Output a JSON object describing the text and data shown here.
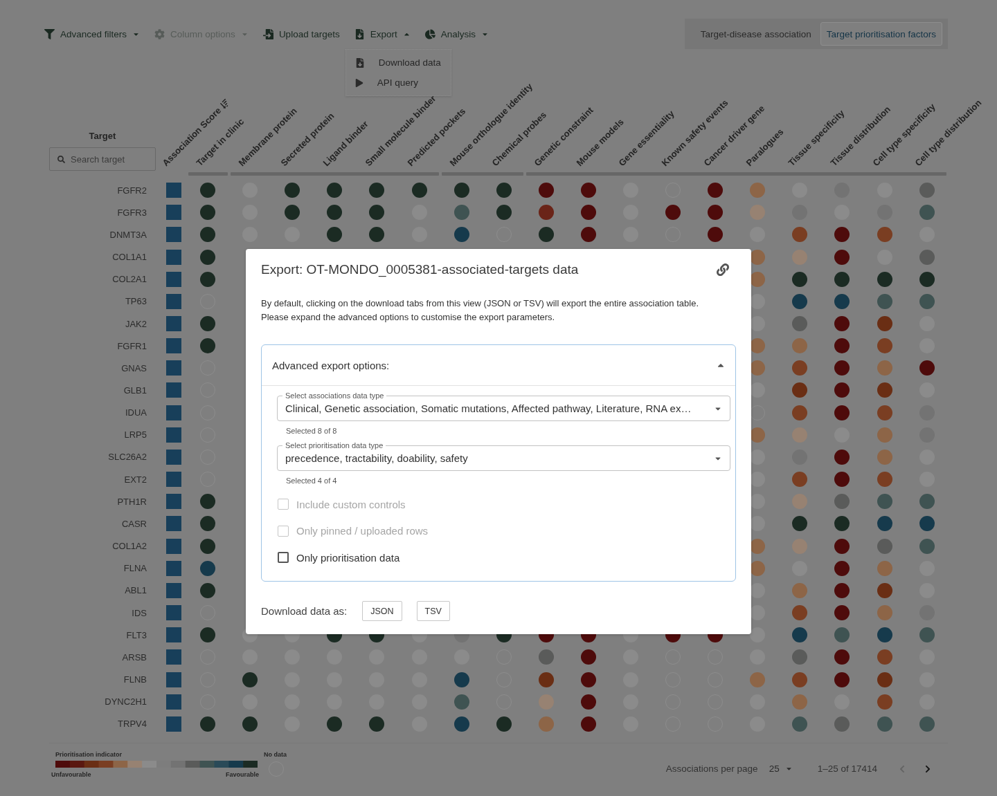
{
  "toolbar": [
    {
      "kind": "filter",
      "label": "Advanced filters",
      "disabled": false,
      "expanded": false
    },
    {
      "kind": "columns",
      "label": "Column options",
      "disabled": true,
      "expanded": false
    },
    {
      "kind": "upload",
      "label": "Upload targets",
      "disabled": false
    },
    {
      "kind": "export",
      "label": "Export",
      "disabled": false,
      "expanded": true,
      "menu": [
        {
          "kind": "download",
          "label": "Download data"
        },
        {
          "kind": "api",
          "label": "API query"
        }
      ]
    },
    {
      "kind": "analysis",
      "label": "Analysis",
      "disabled": false,
      "expanded": false
    }
  ],
  "view_toggle": [
    {
      "label": "Target-disease association",
      "selected": false
    },
    {
      "label": "Target prioritisation factors",
      "selected": true
    }
  ],
  "table": {
    "target_heading": "Target",
    "search": {
      "placeholder": "Search target"
    },
    "score_column": {
      "label": "Association Score",
      "sorted": true
    },
    "column_groups": [
      {
        "columns": [
          "Target in clinic"
        ]
      },
      {
        "columns": [
          "Membrane protein",
          "Secreted protein",
          "Ligand binder",
          "Small molecule binder",
          "Predicted pockets"
        ]
      },
      {
        "columns": [
          "Mouse orthologue identity",
          "Chemical probes"
        ]
      },
      {
        "columns": [
          "Genetic constraint",
          "Mouse models",
          "Gene essentiality",
          "Known safety events",
          "Cancer driver gene",
          "Paralogues",
          "Tissue specificity",
          "Tissue distribution",
          "Cell type specificity",
          "Cell type distribution"
        ]
      }
    ],
    "rows": [
      {
        "target": "FGFR2",
        "score": {
          "color": "#183f5a"
        },
        "cells": [
          {
            "kind": "dot",
            "color": "#1b2b23"
          },
          {
            "kind": "dot",
            "color": "#8b8b8b"
          },
          {
            "kind": "dot",
            "color": "#1b2b23"
          },
          {
            "kind": "dot",
            "color": "#1b2b23"
          },
          {
            "kind": "dot",
            "color": "#1b2b23"
          },
          {
            "kind": "dot",
            "color": "#1b2b23"
          },
          {
            "kind": "dot",
            "color": "#1b2b23"
          },
          {
            "kind": "dot",
            "color": "#1b2b23"
          },
          {
            "kind": "dot",
            "color": "#4e0b0b"
          },
          {
            "kind": "dot",
            "color": "#4e0b0b"
          },
          {
            "kind": "dot",
            "color": "#8b8b8b"
          },
          {
            "kind": "empty"
          },
          {
            "kind": "dot",
            "color": "#4e0b0b"
          },
          {
            "kind": "dot",
            "color": "#8d6547"
          },
          {
            "kind": "dot",
            "color": "#8b8b8b"
          },
          {
            "kind": "dot",
            "color": "#737373"
          },
          {
            "kind": "dot",
            "color": "#8b8b8b"
          },
          {
            "kind": "dot",
            "color": "#5a5b5a"
          }
        ]
      },
      {
        "target": "FGFR3",
        "score": {
          "color": "#183f5a"
        },
        "cells": [
          {
            "kind": "dot",
            "color": "#1b2b23"
          },
          {
            "kind": "dot",
            "color": "#8b8b8b"
          },
          {
            "kind": "dot",
            "color": "#1b2b23"
          },
          {
            "kind": "dot",
            "color": "#1b2b23"
          },
          {
            "kind": "dot",
            "color": "#1b2b23"
          },
          {
            "kind": "dot",
            "color": "#8b8b8b"
          },
          {
            "kind": "dot",
            "color": "#3f5352"
          },
          {
            "kind": "dot",
            "color": "#1b2b23"
          },
          {
            "kind": "dot",
            "color": "#6a2418"
          },
          {
            "kind": "dot",
            "color": "#4e0b0b"
          },
          {
            "kind": "dot",
            "color": "#8b8b8b"
          },
          {
            "kind": "dot",
            "color": "#4e0b0b"
          },
          {
            "kind": "dot",
            "color": "#4e0b0b"
          },
          {
            "kind": "dot",
            "color": "#978272"
          },
          {
            "kind": "dot",
            "color": "#737373"
          },
          {
            "kind": "dot",
            "color": "#8b8b8b"
          },
          {
            "kind": "dot",
            "color": "#737373"
          },
          {
            "kind": "dot",
            "color": "#3f5352"
          }
        ]
      },
      {
        "target": "DNMT3A",
        "score": {
          "color": "#183f5a"
        },
        "cells": [
          {
            "kind": "dot",
            "color": "#1b2b23"
          },
          {
            "kind": "dot",
            "color": "#8b8b8b"
          },
          {
            "kind": "dot",
            "color": "#8b8b8b"
          },
          {
            "kind": "dot",
            "color": "#1b2b23"
          },
          {
            "kind": "dot",
            "color": "#1b2b23"
          },
          {
            "kind": "dot",
            "color": "#8b8b8b"
          },
          {
            "kind": "dot",
            "color": "#163a4c"
          },
          {
            "kind": "empty"
          },
          {
            "kind": "dot",
            "color": "#1b2b23"
          },
          {
            "kind": "dot",
            "color": "#4e0b0b"
          },
          {
            "kind": "dot",
            "color": "#8b8b8b"
          },
          {
            "kind": "empty"
          },
          {
            "kind": "dot",
            "color": "#4e0b0b"
          },
          {
            "kind": "dot",
            "color": "#8b8b8b"
          },
          {
            "kind": "dot",
            "color": "#7a3e22"
          },
          {
            "kind": "dot",
            "color": "#4e0b0b"
          },
          {
            "kind": "dot",
            "color": "#7a3e22"
          },
          {
            "kind": "dot",
            "color": "#8b8b8b"
          }
        ]
      },
      {
        "target": "COL1A1",
        "score": {
          "color": "#183f5a"
        },
        "cells": [
          {
            "kind": "dot",
            "color": "#1b2b23"
          },
          null,
          null,
          null,
          null,
          null,
          null,
          null,
          null,
          null,
          null,
          null,
          null,
          {
            "kind": "dot",
            "color": "#8d6547"
          },
          {
            "kind": "dot",
            "color": "#978272"
          },
          {
            "kind": "dot",
            "color": "#4e0b0b"
          },
          {
            "kind": "dot",
            "color": "#8b8b8b"
          },
          {
            "kind": "dot",
            "color": "#5a5b5a"
          }
        ]
      },
      {
        "target": "COL2A1",
        "score": {
          "color": "#183f5a"
        },
        "cells": [
          {
            "kind": "dot",
            "color": "#1b2b23"
          },
          null,
          null,
          null,
          null,
          null,
          null,
          null,
          null,
          null,
          null,
          null,
          null,
          {
            "kind": "dot",
            "color": "#8d6547"
          },
          {
            "kind": "dot",
            "color": "#1b2b23"
          },
          {
            "kind": "dot",
            "color": "#1b2b23"
          },
          {
            "kind": "dot",
            "color": "#1b2b23"
          },
          {
            "kind": "dot",
            "color": "#1b2b23"
          }
        ]
      },
      {
        "target": "TP63",
        "score": {
          "color": "#183f5a"
        },
        "cells": [
          {
            "kind": "empty"
          },
          null,
          null,
          null,
          null,
          null,
          null,
          null,
          null,
          null,
          null,
          null,
          null,
          {
            "kind": "dot",
            "color": "#8b8b8b"
          },
          {
            "kind": "dot",
            "color": "#163a4c"
          },
          {
            "kind": "dot",
            "color": "#163a4c"
          },
          {
            "kind": "dot",
            "color": "#3f5352"
          },
          {
            "kind": "dot",
            "color": "#3f5352"
          }
        ]
      },
      {
        "target": "JAK2",
        "score": {
          "color": "#183f5a"
        },
        "cells": [
          {
            "kind": "dot",
            "color": "#1b2b23"
          },
          null,
          null,
          null,
          null,
          null,
          null,
          null,
          null,
          null,
          null,
          null,
          null,
          {
            "kind": "dot",
            "color": "#8b8b8b"
          },
          {
            "kind": "dot",
            "color": "#5a5b5a"
          },
          {
            "kind": "dot",
            "color": "#4e0b0b"
          },
          {
            "kind": "dot",
            "color": "#6a2e14"
          },
          {
            "kind": "dot",
            "color": "#8b8b8b"
          }
        ]
      },
      {
        "target": "FGFR1",
        "score": {
          "color": "#183f5a"
        },
        "cells": [
          {
            "kind": "dot",
            "color": "#1b2b23"
          },
          null,
          null,
          null,
          null,
          null,
          null,
          null,
          null,
          null,
          null,
          null,
          null,
          {
            "kind": "dot",
            "color": "#8d6547"
          },
          {
            "kind": "dot",
            "color": "#8d6547"
          },
          {
            "kind": "dot",
            "color": "#4e0b0b"
          },
          {
            "kind": "dot",
            "color": "#7a3e22"
          },
          {
            "kind": "dot",
            "color": "#8b8b8b"
          }
        ]
      },
      {
        "target": "GNAS",
        "score": {
          "color": "#183f5a"
        },
        "cells": [
          {
            "kind": "empty"
          },
          null,
          null,
          null,
          null,
          null,
          null,
          null,
          null,
          null,
          null,
          null,
          null,
          {
            "kind": "dot",
            "color": "#8d6547"
          },
          {
            "kind": "dot",
            "color": "#7a3e22"
          },
          {
            "kind": "dot",
            "color": "#4e0b0b"
          },
          {
            "kind": "dot",
            "color": "#8d6547"
          },
          {
            "kind": "dot",
            "color": "#4e0b0b"
          }
        ]
      },
      {
        "target": "GLB1",
        "score": {
          "color": "#183f5a"
        },
        "cells": [
          {
            "kind": "empty"
          },
          null,
          null,
          null,
          null,
          null,
          null,
          null,
          null,
          null,
          null,
          null,
          null,
          {
            "kind": "dot",
            "color": "#8b8b8b"
          },
          {
            "kind": "dot",
            "color": "#6a2e14"
          },
          {
            "kind": "dot",
            "color": "#4e0b0b"
          },
          {
            "kind": "dot",
            "color": "#6a2e14"
          },
          {
            "kind": "dot",
            "color": "#8b8b8b"
          }
        ]
      },
      {
        "target": "IDUA",
        "score": {
          "color": "#183f5a"
        },
        "cells": [
          {
            "kind": "empty"
          },
          null,
          null,
          null,
          null,
          null,
          null,
          null,
          null,
          null,
          null,
          null,
          null,
          {
            "kind": "empty"
          },
          {
            "kind": "dot",
            "color": "#7a3e22"
          },
          {
            "kind": "dot",
            "color": "#4e0b0b"
          },
          {
            "kind": "dot",
            "color": "#7a3e22"
          },
          {
            "kind": "dot",
            "color": "#737373"
          }
        ]
      },
      {
        "target": "LRP5",
        "score": {
          "color": "#183f5a"
        },
        "cells": [
          {
            "kind": "empty"
          },
          null,
          null,
          null,
          null,
          null,
          null,
          null,
          null,
          null,
          null,
          null,
          null,
          {
            "kind": "dot",
            "color": "#8d6547"
          },
          {
            "kind": "dot",
            "color": "#978272"
          },
          {
            "kind": "dot",
            "color": "#8b8b8b"
          },
          {
            "kind": "dot",
            "color": "#8d6547"
          },
          {
            "kind": "dot",
            "color": "#737373"
          }
        ]
      },
      {
        "target": "SLC26A2",
        "score": {
          "color": "#183f5a"
        },
        "cells": [
          {
            "kind": "empty"
          },
          null,
          null,
          null,
          null,
          null,
          null,
          null,
          null,
          null,
          null,
          null,
          null,
          {
            "kind": "dot",
            "color": "#8b8b8b"
          },
          {
            "kind": "dot",
            "color": "#737373"
          },
          {
            "kind": "dot",
            "color": "#4e0b0b"
          },
          {
            "kind": "dot",
            "color": "#8d6547"
          },
          {
            "kind": "dot",
            "color": "#8b8b8b"
          }
        ]
      },
      {
        "target": "EXT2",
        "score": {
          "color": "#183f5a"
        },
        "cells": [
          {
            "kind": "empty"
          },
          null,
          null,
          null,
          null,
          null,
          null,
          null,
          null,
          null,
          null,
          null,
          null,
          {
            "kind": "dot",
            "color": "#8b8b8b"
          },
          {
            "kind": "dot",
            "color": "#7a3e22"
          },
          {
            "kind": "dot",
            "color": "#4e0b0b"
          },
          {
            "kind": "dot",
            "color": "#7a3e22"
          },
          {
            "kind": "dot",
            "color": "#8b8b8b"
          }
        ]
      },
      {
        "target": "PTH1R",
        "score": {
          "color": "#183f5a"
        },
        "cells": [
          {
            "kind": "dot",
            "color": "#1b2b23"
          },
          null,
          null,
          null,
          null,
          null,
          null,
          null,
          null,
          null,
          null,
          null,
          null,
          {
            "kind": "dot",
            "color": "#8b8b8b"
          },
          {
            "kind": "dot",
            "color": "#978272"
          },
          {
            "kind": "dot",
            "color": "#5a5b5a"
          },
          {
            "kind": "dot",
            "color": "#3f5352"
          },
          {
            "kind": "dot",
            "color": "#3f5352"
          }
        ]
      },
      {
        "target": "CASR",
        "score": {
          "color": "#183f5a"
        },
        "cells": [
          {
            "kind": "dot",
            "color": "#1b2b23"
          },
          null,
          null,
          null,
          null,
          null,
          null,
          null,
          null,
          null,
          null,
          null,
          null,
          {
            "kind": "dot",
            "color": "#8b8b8b"
          },
          {
            "kind": "dot",
            "color": "#1b2b23"
          },
          {
            "kind": "dot",
            "color": "#1b2b23"
          },
          {
            "kind": "dot",
            "color": "#163a4c"
          },
          {
            "kind": "dot",
            "color": "#163a4c"
          }
        ]
      },
      {
        "target": "COL1A2",
        "score": {
          "color": "#183f5a"
        },
        "cells": [
          {
            "kind": "dot",
            "color": "#1b2b23"
          },
          null,
          null,
          null,
          null,
          null,
          null,
          null,
          null,
          null,
          null,
          null,
          null,
          {
            "kind": "dot",
            "color": "#8d6547"
          },
          {
            "kind": "dot",
            "color": "#978272"
          },
          {
            "kind": "dot",
            "color": "#4e0b0b"
          },
          {
            "kind": "dot",
            "color": "#5a5b5a"
          },
          {
            "kind": "dot",
            "color": "#3f5352"
          }
        ]
      },
      {
        "target": "FLNA",
        "score": {
          "color": "#183f5a"
        },
        "cells": [
          {
            "kind": "dot",
            "color": "#163a4c"
          },
          null,
          null,
          null,
          null,
          null,
          null,
          null,
          null,
          null,
          null,
          null,
          null,
          {
            "kind": "dot",
            "color": "#8d6547"
          },
          {
            "kind": "dot",
            "color": "#8b8b8b"
          },
          {
            "kind": "dot",
            "color": "#4e0b0b"
          },
          {
            "kind": "dot",
            "color": "#8d6547"
          },
          {
            "kind": "dot",
            "color": "#8b8b8b"
          }
        ]
      },
      {
        "target": "ABL1",
        "score": {
          "color": "#183f5a"
        },
        "cells": [
          {
            "kind": "dot",
            "color": "#1b2b23"
          },
          null,
          null,
          null,
          null,
          null,
          null,
          null,
          null,
          null,
          null,
          null,
          null,
          {
            "kind": "dot",
            "color": "#8b8b8b"
          },
          {
            "kind": "dot",
            "color": "#8d6547"
          },
          {
            "kind": "dot",
            "color": "#4e0b0b"
          },
          {
            "kind": "dot",
            "color": "#6a2e14"
          },
          {
            "kind": "dot",
            "color": "#8b8b8b"
          }
        ]
      },
      {
        "target": "IDS",
        "score": {
          "color": "#183f5a"
        },
        "cells": [
          {
            "kind": "empty"
          },
          null,
          null,
          null,
          null,
          null,
          null,
          null,
          null,
          null,
          null,
          null,
          null,
          {
            "kind": "dot",
            "color": "#8b8b8b"
          },
          {
            "kind": "dot",
            "color": "#7a3e22"
          },
          {
            "kind": "dot",
            "color": "#4e0b0b"
          },
          {
            "kind": "dot",
            "color": "#8d6547"
          },
          {
            "kind": "dot",
            "color": "#737373"
          }
        ]
      },
      {
        "target": "FLT3",
        "score": {
          "color": "#183f5a"
        },
        "cells": [
          {
            "kind": "dot",
            "color": "#1b2b23"
          },
          {
            "kind": "dot",
            "color": "#8b8b8b"
          },
          {
            "kind": "dot",
            "color": "#8b8b8b"
          },
          {
            "kind": "dot",
            "color": "#1b2b23"
          },
          {
            "kind": "dot",
            "color": "#1b2b23"
          },
          {
            "kind": "dot",
            "color": "#8b8b8b"
          },
          {
            "kind": "dot",
            "color": "#737373"
          },
          {
            "kind": "dot",
            "color": "#1b2b23"
          },
          {
            "kind": "dot",
            "color": "#4e0b0b"
          },
          {
            "kind": "dot",
            "color": "#4e0b0b"
          },
          {
            "kind": "dot",
            "color": "#8b8b8b"
          },
          {
            "kind": "dot",
            "color": "#4e0b0b"
          },
          {
            "kind": "dot",
            "color": "#4e0b0b"
          },
          {
            "kind": "dot",
            "color": "#8b8b8b"
          },
          {
            "kind": "dot",
            "color": "#163a4c"
          },
          {
            "kind": "dot",
            "color": "#3f5352"
          },
          {
            "kind": "dot",
            "color": "#163a4c"
          },
          {
            "kind": "dot",
            "color": "#3f5352"
          }
        ]
      },
      {
        "target": "ARSB",
        "score": {
          "color": "#183f5a"
        },
        "cells": [
          {
            "kind": "empty"
          },
          {
            "kind": "dot",
            "color": "#8b8b8b"
          },
          {
            "kind": "dot",
            "color": "#8b8b8b"
          },
          {
            "kind": "dot",
            "color": "#8b8b8b"
          },
          {
            "kind": "dot",
            "color": "#8b8b8b"
          },
          {
            "kind": "dot",
            "color": "#8b8b8b"
          },
          {
            "kind": "dot",
            "color": "#8b8b8b"
          },
          {
            "kind": "empty"
          },
          {
            "kind": "dot",
            "color": "#5a5b5a"
          },
          {
            "kind": "dot",
            "color": "#4e0b0b"
          },
          {
            "kind": "dot",
            "color": "#8b8b8b"
          },
          {
            "kind": "empty"
          },
          {
            "kind": "empty"
          },
          {
            "kind": "dot",
            "color": "#8b8b8b"
          },
          {
            "kind": "dot",
            "color": "#5a5b5a"
          },
          {
            "kind": "dot",
            "color": "#4e0b0b"
          },
          {
            "kind": "dot",
            "color": "#7a3e22"
          },
          {
            "kind": "dot",
            "color": "#8b8b8b"
          }
        ]
      },
      {
        "target": "FLNB",
        "score": {
          "color": "#183f5a"
        },
        "cells": [
          {
            "kind": "empty"
          },
          {
            "kind": "dot",
            "color": "#1b2b23"
          },
          {
            "kind": "dot",
            "color": "#8b8b8b"
          },
          {
            "kind": "dot",
            "color": "#8b8b8b"
          },
          {
            "kind": "dot",
            "color": "#8b8b8b"
          },
          {
            "kind": "dot",
            "color": "#8b8b8b"
          },
          {
            "kind": "dot",
            "color": "#163a4c"
          },
          {
            "kind": "empty"
          },
          {
            "kind": "dot",
            "color": "#6a2e14"
          },
          {
            "kind": "dot",
            "color": "#4e0b0b"
          },
          {
            "kind": "dot",
            "color": "#8b8b8b"
          },
          {
            "kind": "empty"
          },
          {
            "kind": "empty"
          },
          {
            "kind": "dot",
            "color": "#8d6547"
          },
          {
            "kind": "dot",
            "color": "#7a3e22"
          },
          {
            "kind": "dot",
            "color": "#4e0b0b"
          },
          {
            "kind": "dot",
            "color": "#6a2e14"
          },
          {
            "kind": "dot",
            "color": "#8b8b8b"
          }
        ]
      },
      {
        "target": "DYNC2H1",
        "score": {
          "color": "#183f5a"
        },
        "cells": [
          {
            "kind": "empty"
          },
          {
            "kind": "dot",
            "color": "#8b8b8b"
          },
          {
            "kind": "dot",
            "color": "#8b8b8b"
          },
          {
            "kind": "dot",
            "color": "#8b8b8b"
          },
          {
            "kind": "dot",
            "color": "#8b8b8b"
          },
          {
            "kind": "dot",
            "color": "#8b8b8b"
          },
          {
            "kind": "dot",
            "color": "#3f5352"
          },
          {
            "kind": "empty"
          },
          {
            "kind": "dot",
            "color": "#978272"
          },
          {
            "kind": "dot",
            "color": "#4e0b0b"
          },
          {
            "kind": "dot",
            "color": "#8b8b8b"
          },
          {
            "kind": "empty"
          },
          {
            "kind": "empty"
          },
          {
            "kind": "dot",
            "color": "#8b8b8b"
          },
          {
            "kind": "dot",
            "color": "#8d6547"
          },
          {
            "kind": "dot",
            "color": "#8b8b8b"
          },
          {
            "kind": "dot",
            "color": "#7a3e22"
          },
          {
            "kind": "dot",
            "color": "#8b8b8b"
          }
        ]
      },
      {
        "target": "TRPV4",
        "score": {
          "color": "#183f5a"
        },
        "cells": [
          {
            "kind": "dot",
            "color": "#1b2b23"
          },
          {
            "kind": "dot",
            "color": "#1b2b23"
          },
          {
            "kind": "dot",
            "color": "#8b8b8b"
          },
          {
            "kind": "dot",
            "color": "#1b2b23"
          },
          {
            "kind": "dot",
            "color": "#1b2b23"
          },
          {
            "kind": "dot",
            "color": "#8b8b8b"
          },
          {
            "kind": "dot",
            "color": "#163a4c"
          },
          {
            "kind": "dot",
            "color": "#1b2b23"
          },
          {
            "kind": "dot",
            "color": "#8d6547"
          },
          {
            "kind": "dot",
            "color": "#4e0b0b"
          },
          {
            "kind": "dot",
            "color": "#8b8b8b"
          },
          {
            "kind": "empty"
          },
          {
            "kind": "empty"
          },
          {
            "kind": "dot",
            "color": "#8b8b8b"
          },
          {
            "kind": "dot",
            "color": "#3f5352"
          },
          {
            "kind": "dot",
            "color": "#5a5b5a"
          },
          {
            "kind": "dot",
            "color": "#3f5352"
          },
          {
            "kind": "dot",
            "color": "#3f5352"
          }
        ]
      }
    ]
  },
  "legend": {
    "title": "Prioritisation indicator",
    "low_label": "Unfavourable",
    "high_label": "Favourable",
    "no_data_label": "No data"
  },
  "pagination": {
    "per_page_label": "Associations per page",
    "per_page": "25",
    "range": "1–25 of 17414",
    "prev_disabled": true,
    "next_disabled": false
  },
  "export_dialog": {
    "title": "Export: OT-MONDO_0005381-associated-targets data",
    "description": [
      "By default, clicking on the download tabs from this view (JSON or TSV) will export the entire association table.",
      "Please expand the advanced options to customise the export parameters."
    ],
    "advanced": {
      "title": "Advanced export options:",
      "expanded": true,
      "selects": [
        {
          "label": "Select associations data type",
          "value": "Clinical, Genetic association, Somatic mutations, Affected pathway, Literature, RNA ex…",
          "helper": "Selected 8 of 8"
        },
        {
          "label": "Select prioritisation data type",
          "value": "precedence, tractability, doability, safety",
          "helper": "Selected 4 of 4"
        }
      ],
      "checkboxes": [
        {
          "label": "Include custom controls",
          "checked": false,
          "disabled": true
        },
        {
          "label": "Only pinned / uploaded rows",
          "checked": false,
          "disabled": true
        },
        {
          "label": "Only prioritisation data",
          "checked": false,
          "disabled": false
        }
      ]
    },
    "download_label": "Download data as:",
    "formats": [
      "JSON",
      "TSV"
    ]
  }
}
